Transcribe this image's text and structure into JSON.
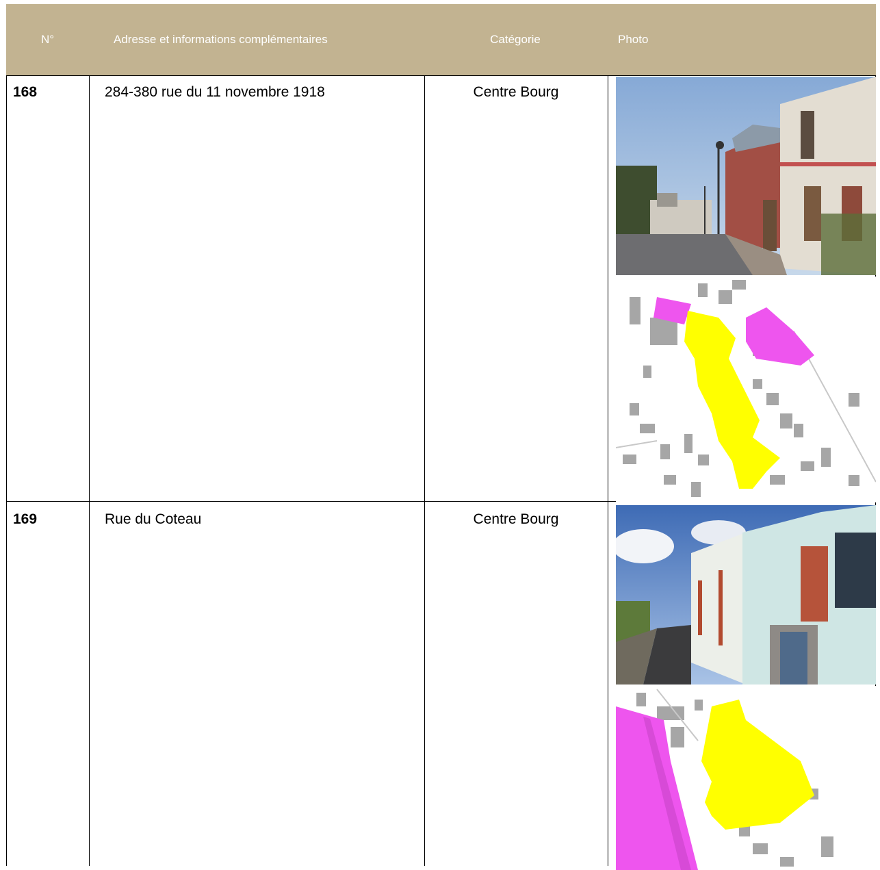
{
  "table": {
    "headers": {
      "num": "N°",
      "address": "Adresse et informations complémentaires",
      "category": "Catégorie",
      "photo": "Photo"
    },
    "rows": [
      {
        "num": "168",
        "address": "284-380 rue du 11 novembre 1918",
        "category": "Centre Bourg",
        "images": [
          "street-photo",
          "cadastral-map"
        ]
      },
      {
        "num": "169",
        "address": "Rue du Coteau",
        "category": "Centre Bourg",
        "images": [
          "street-photo",
          "cadastral-map"
        ]
      }
    ]
  },
  "colors": {
    "header_bg": "#c2b391",
    "header_text": "#ffffff",
    "map_highlight_yellow": "#ffff00",
    "map_highlight_magenta": "#ee55ee",
    "map_building_grey": "#a6a6a6"
  }
}
